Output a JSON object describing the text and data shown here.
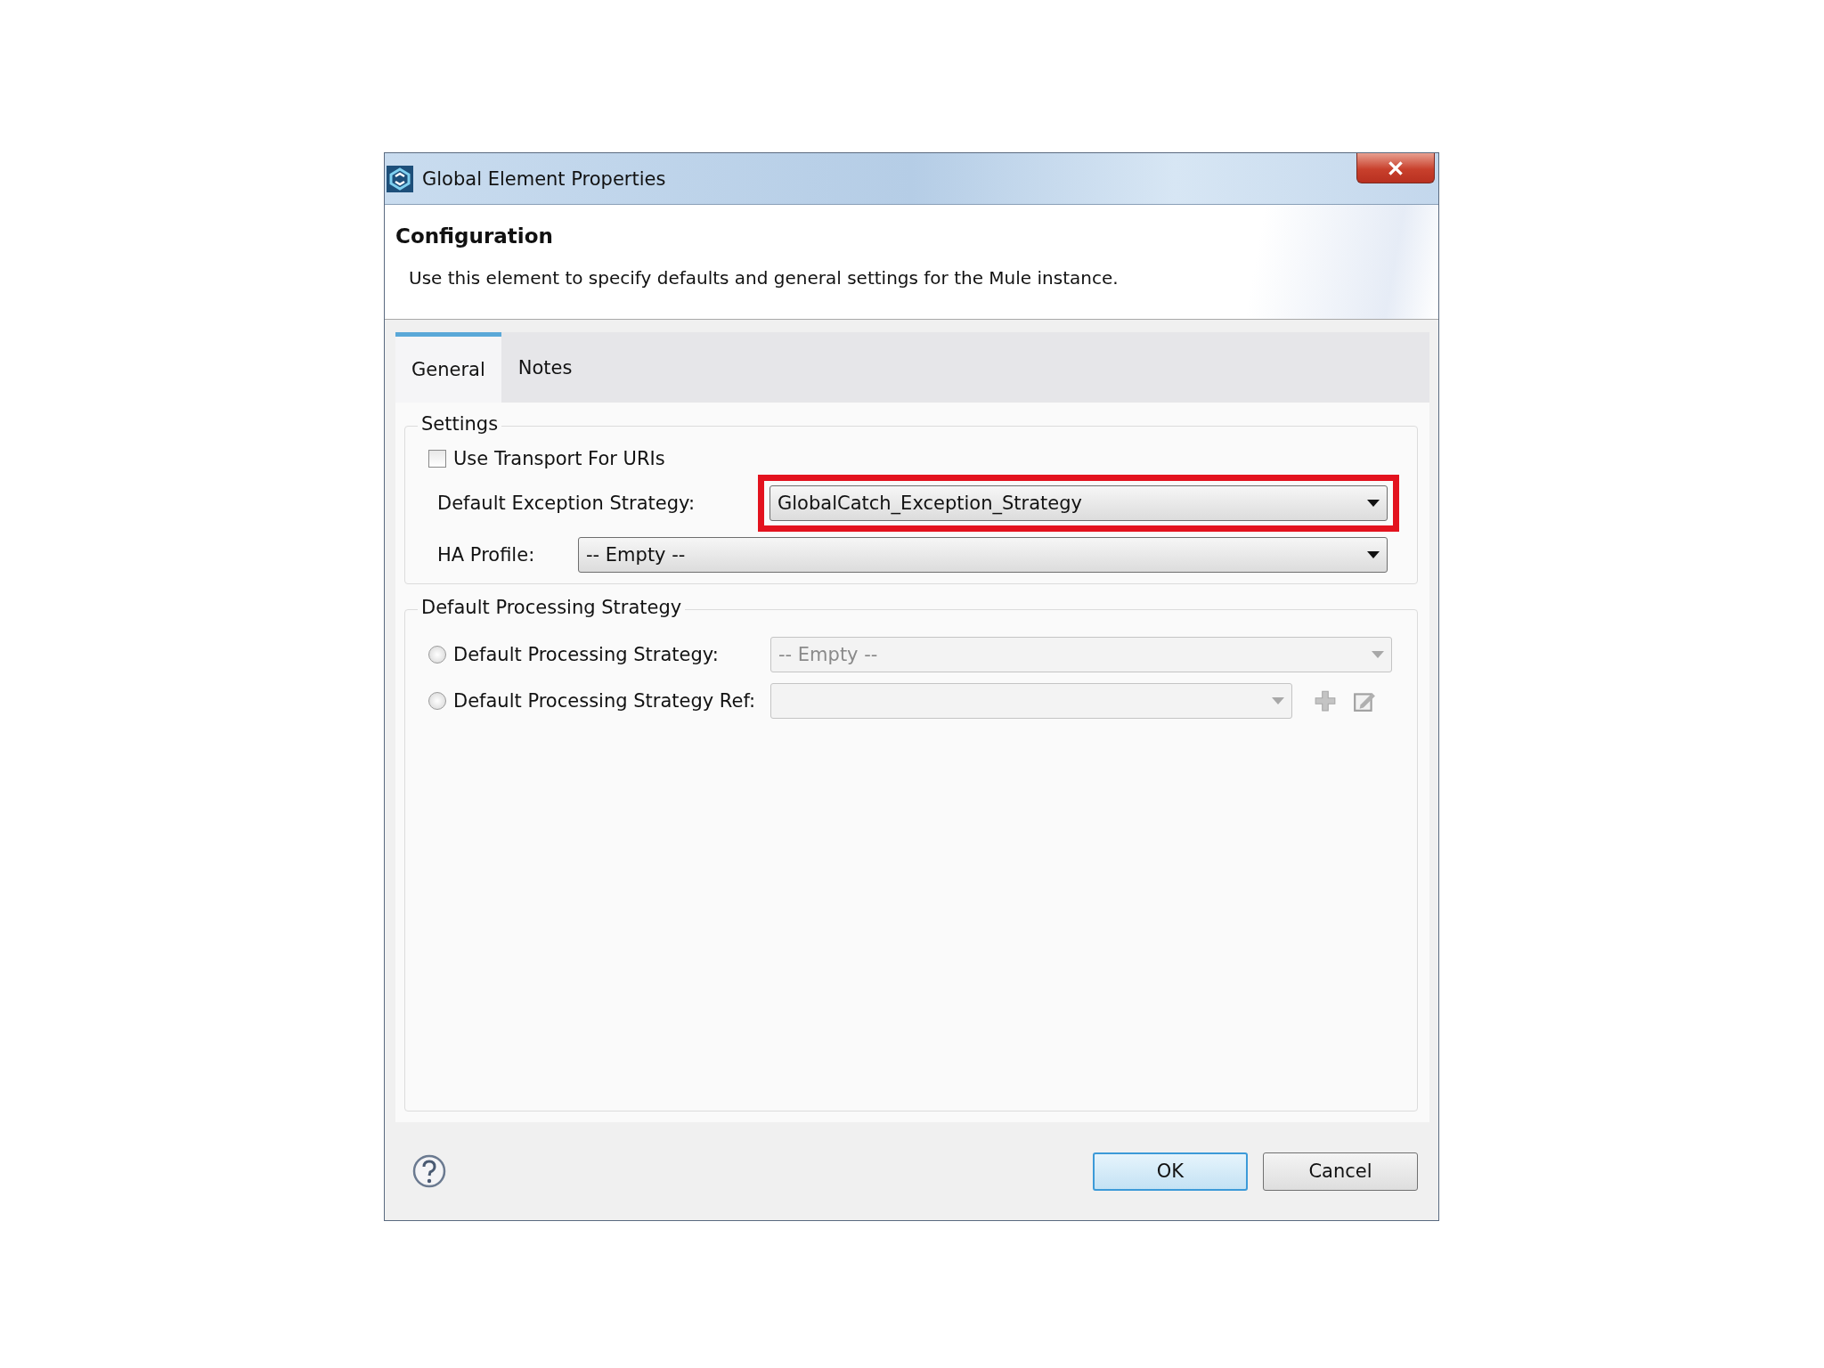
{
  "window": {
    "title": "Global Element Properties"
  },
  "header": {
    "title": "Configuration",
    "description": "Use this element to specify defaults and general settings for the Mule instance."
  },
  "tabs": [
    {
      "label": "General",
      "selected": true
    },
    {
      "label": "Notes",
      "selected": false
    }
  ],
  "settings": {
    "title": "Settings",
    "checkbox": {
      "label": "Use Transport For URIs",
      "checked": false
    },
    "fields": [
      {
        "label": "Default Exception Strategy:",
        "value": "GlobalCatch_Exception_Strategy",
        "highlighted": true,
        "wide_label": true
      },
      {
        "label": "HA Profile:",
        "value": "-- Empty --",
        "highlighted": false,
        "wide_label": false
      }
    ]
  },
  "processing": {
    "title": "Default Processing Strategy",
    "options": [
      {
        "label": "Default Processing Strategy:",
        "selected": false,
        "value": "-- Empty --",
        "disabled": true,
        "actions": false
      },
      {
        "label": "Default Processing Strategy Ref:",
        "selected": false,
        "disabled": true,
        "actions": true
      }
    ]
  },
  "buttons": [
    {
      "label": "OK",
      "default": true
    },
    {
      "label": "Cancel",
      "default": false
    }
  ]
}
